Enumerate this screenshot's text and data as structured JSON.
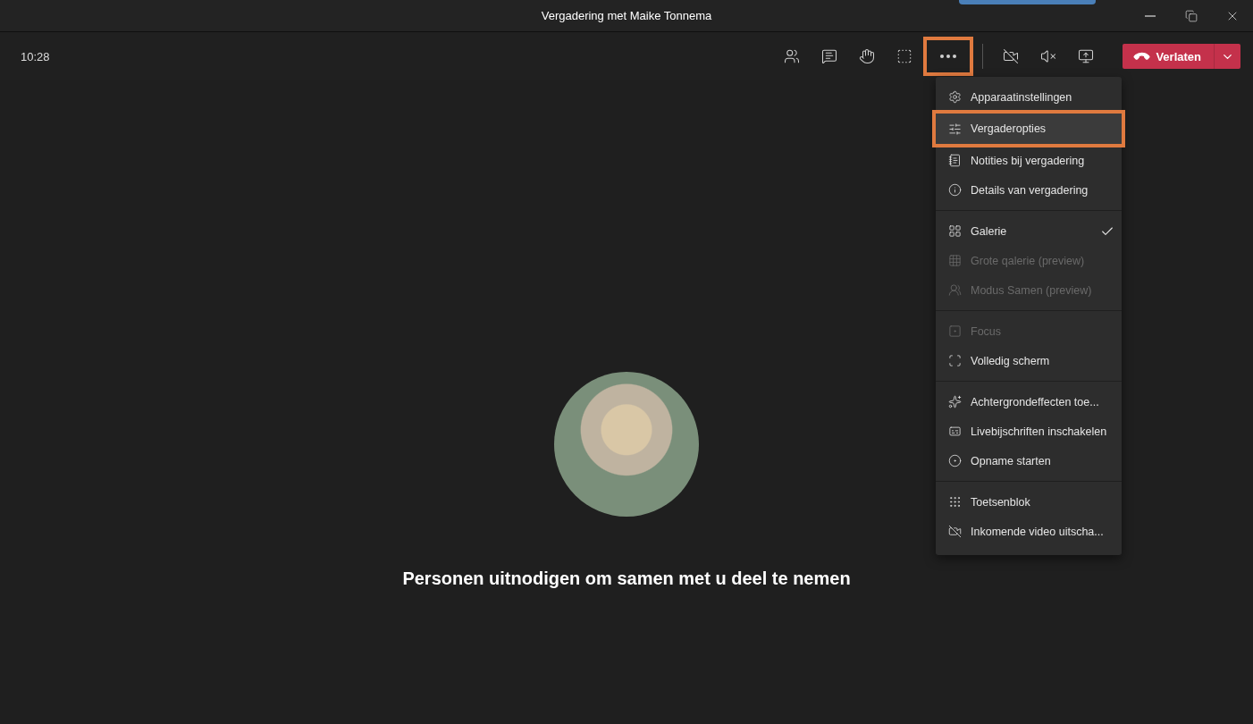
{
  "window": {
    "title": "Vergadering met Maike Tonnema"
  },
  "toolbar": {
    "time": "10:28",
    "buttons": [
      {
        "kind": "people",
        "highlighted": false
      },
      {
        "kind": "chat",
        "highlighted": false
      },
      {
        "kind": "hand",
        "highlighted": false
      },
      {
        "kind": "rooms",
        "highlighted": false
      },
      {
        "kind": "more",
        "highlighted": true
      },
      {
        "kind": "camera",
        "highlighted": false
      },
      {
        "kind": "mute",
        "highlighted": false
      },
      {
        "kind": "share",
        "highlighted": false
      }
    ],
    "leave_button": {
      "label": "Verlaten"
    }
  },
  "menu": {
    "groups": [
      {
        "items": [
          {
            "kind": "settings",
            "label": "Apparaatinstellingen",
            "disabled": false,
            "checked": false,
            "highlighted": false
          },
          {
            "kind": "sliders",
            "label": "Vergaderopties",
            "disabled": false,
            "checked": false,
            "highlighted": true
          },
          {
            "kind": "notes",
            "label": "Notities bij vergadering",
            "disabled": false,
            "checked": false,
            "highlighted": false
          },
          {
            "kind": "info",
            "label": "Details van vergadering",
            "disabled": false,
            "checked": false,
            "highlighted": false
          }
        ]
      },
      {
        "items": [
          {
            "kind": "grid",
            "label": "Galerie",
            "disabled": false,
            "checked": true,
            "highlighted": false
          },
          {
            "kind": "biggrid",
            "label": "Grote qalerie (preview)",
            "disabled": true,
            "checked": false,
            "highlighted": false
          },
          {
            "kind": "together",
            "label": "Modus Samen (preview)",
            "disabled": true,
            "checked": false,
            "highlighted": false
          }
        ]
      },
      {
        "items": [
          {
            "kind": "focus",
            "label": "Focus",
            "disabled": true,
            "checked": false,
            "highlighted": false
          },
          {
            "kind": "fullscreen",
            "label": "Volledig scherm",
            "disabled": false,
            "checked": false,
            "highlighted": false
          }
        ]
      },
      {
        "items": [
          {
            "kind": "effects",
            "label": "Achtergrondeffecten toe...",
            "disabled": false,
            "checked": false,
            "highlighted": false
          },
          {
            "kind": "captions",
            "label": "Livebijschriften inschakelen",
            "disabled": false,
            "checked": false,
            "highlighted": false
          },
          {
            "kind": "record",
            "label": "Opname starten",
            "disabled": false,
            "checked": false,
            "highlighted": false
          }
        ]
      },
      {
        "items": [
          {
            "kind": "keypad",
            "label": "Toetsenblok",
            "disabled": false,
            "checked": false,
            "highlighted": false
          },
          {
            "kind": "video",
            "label": "Inkomende video uitscha...",
            "disabled": false,
            "checked": false,
            "highlighted": false
          }
        ]
      }
    ]
  },
  "stage": {
    "invite_text": "Personen uitnodigen om samen met u deel te nemen"
  }
}
